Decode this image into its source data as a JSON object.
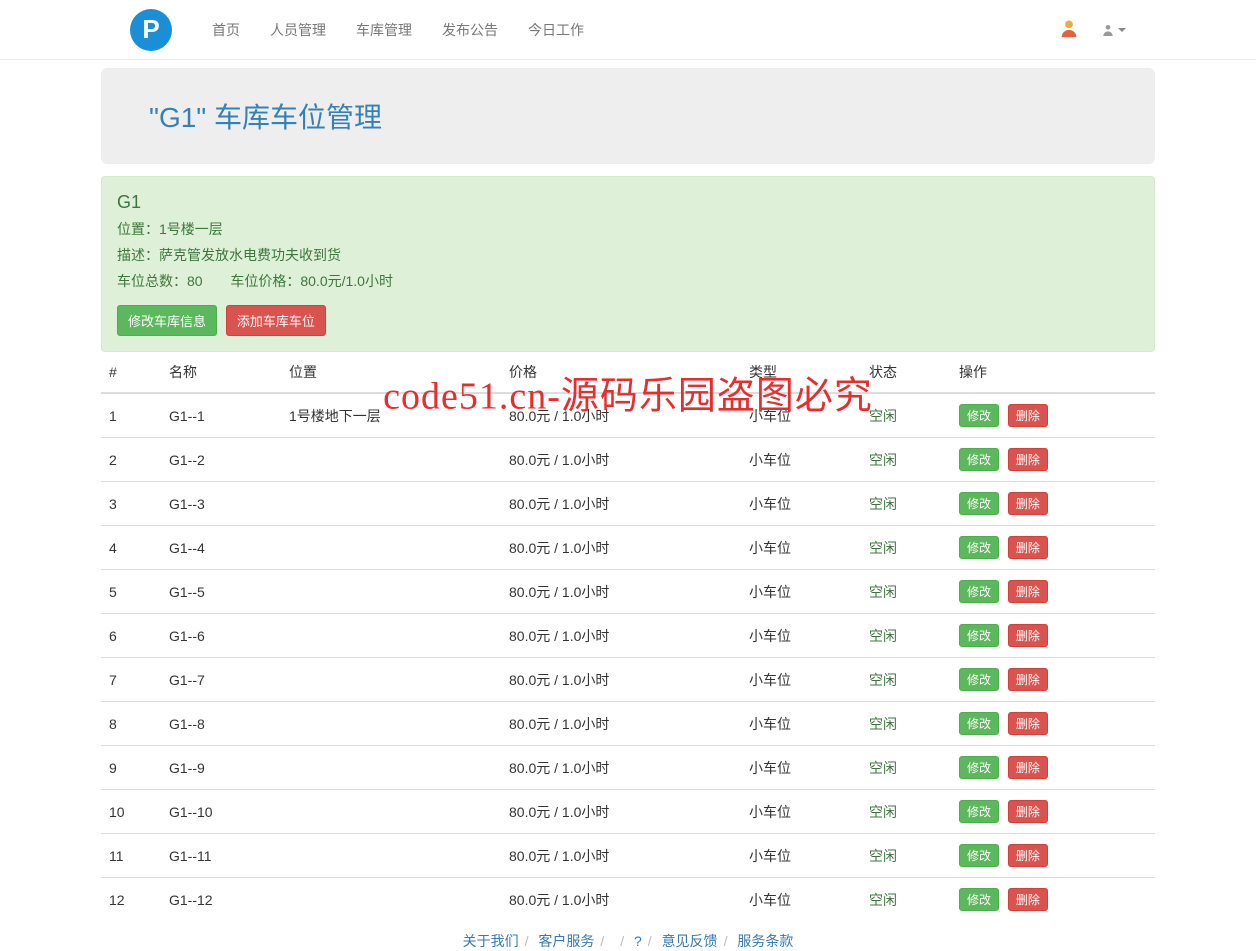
{
  "nav": {
    "logo_letter": "P",
    "links": [
      {
        "label": "首页"
      },
      {
        "label": "人员管理"
      },
      {
        "label": "车库管理"
      },
      {
        "label": "发布公告"
      },
      {
        "label": "今日工作"
      }
    ]
  },
  "page_title": "\"G1\" 车库车位管理",
  "garage": {
    "name": "G1",
    "location_label": "位置：",
    "location": "1号楼一层",
    "desc_label": "描述：",
    "desc": "萨克管发放水电费功夫收到货",
    "total_label": "车位总数：",
    "total": "80",
    "price_label": "车位价格：",
    "price": "80.0元/1.0小时",
    "btn_edit": "修改车库信息",
    "btn_add": "添加车库车位"
  },
  "table": {
    "headers": {
      "id": "#",
      "name": "名称",
      "location": "位置",
      "price": "价格",
      "type": "类型",
      "status": "状态",
      "actions": "操作"
    },
    "row_buttons": {
      "edit": "修改",
      "delete": "删除"
    },
    "rows": [
      {
        "id": "1",
        "name": "G1--1",
        "location": "1号楼地下一层",
        "price": "80.0元 / 1.0小时",
        "type": "小车位",
        "status": "空闲"
      },
      {
        "id": "2",
        "name": "G1--2",
        "location": "",
        "price": "80.0元 / 1.0小时",
        "type": "小车位",
        "status": "空闲"
      },
      {
        "id": "3",
        "name": "G1--3",
        "location": "",
        "price": "80.0元 / 1.0小时",
        "type": "小车位",
        "status": "空闲"
      },
      {
        "id": "4",
        "name": "G1--4",
        "location": "",
        "price": "80.0元 / 1.0小时",
        "type": "小车位",
        "status": "空闲"
      },
      {
        "id": "5",
        "name": "G1--5",
        "location": "",
        "price": "80.0元 / 1.0小时",
        "type": "小车位",
        "status": "空闲"
      },
      {
        "id": "6",
        "name": "G1--6",
        "location": "",
        "price": "80.0元 / 1.0小时",
        "type": "小车位",
        "status": "空闲"
      },
      {
        "id": "7",
        "name": "G1--7",
        "location": "",
        "price": "80.0元 / 1.0小时",
        "type": "小车位",
        "status": "空闲"
      },
      {
        "id": "8",
        "name": "G1--8",
        "location": "",
        "price": "80.0元 / 1.0小时",
        "type": "小车位",
        "status": "空闲"
      },
      {
        "id": "9",
        "name": "G1--9",
        "location": "",
        "price": "80.0元 / 1.0小时",
        "type": "小车位",
        "status": "空闲"
      },
      {
        "id": "10",
        "name": "G1--10",
        "location": "",
        "price": "80.0元 / 1.0小时",
        "type": "小车位",
        "status": "空闲"
      },
      {
        "id": "11",
        "name": "G1--11",
        "location": "",
        "price": "80.0元 / 1.0小时",
        "type": "小车位",
        "status": "空闲"
      },
      {
        "id": "12",
        "name": "G1--12",
        "location": "",
        "price": "80.0元 / 1.0小时",
        "type": "小车位",
        "status": "空闲"
      }
    ]
  },
  "footer": {
    "links": [
      "关于我们",
      "客户服务",
      "",
      "?",
      "意见反馈",
      "服务条款"
    ]
  },
  "watermark": "code51.cn-源码乐园盗图必究"
}
